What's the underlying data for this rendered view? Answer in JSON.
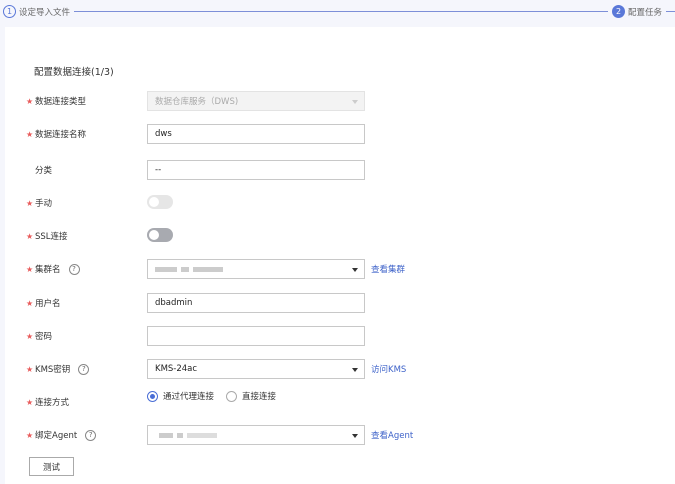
{
  "steps": [
    {
      "num": "1",
      "label": "设定导入文件"
    },
    {
      "num": "2",
      "label": "配置任务"
    }
  ],
  "form": {
    "title": "配置数据连接(1/3)",
    "type": {
      "label": "数据连接类型",
      "value": "数据仓库服务（DWS)"
    },
    "name": {
      "label": "数据连接名称",
      "value": "dws"
    },
    "category": {
      "label": "分类",
      "value": "--"
    },
    "manual": {
      "label": "手动"
    },
    "ssl": {
      "label": "SSL连接"
    },
    "cluster": {
      "label": "集群名",
      "link": "查看集群"
    },
    "user": {
      "label": "用户名",
      "value": "dbadmin"
    },
    "password": {
      "label": "密码",
      "value": ""
    },
    "kms": {
      "label": "KMS密钥",
      "value": "KMS-24ac",
      "link": "访问KMS"
    },
    "mode": {
      "label": "连接方式",
      "options": [
        "通过代理连接",
        "直接连接"
      ]
    },
    "agent": {
      "label": "绑定Agent",
      "link": "查看Agent"
    },
    "test_button": "测试"
  }
}
